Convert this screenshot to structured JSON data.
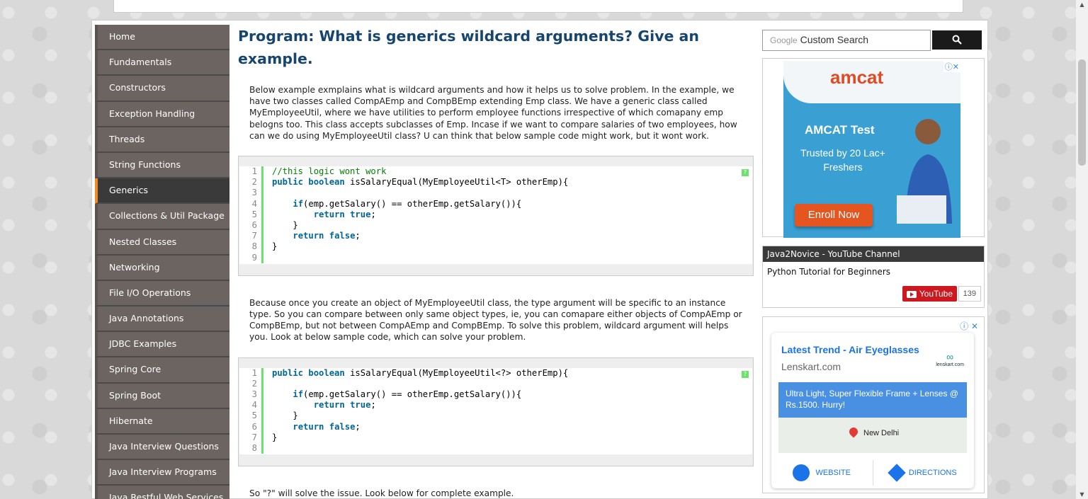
{
  "nav": {
    "items": [
      {
        "label": "Home",
        "active": false
      },
      {
        "label": "Fundamentals",
        "active": false
      },
      {
        "label": "Constructors",
        "active": false
      },
      {
        "label": "Exception Handling",
        "active": false
      },
      {
        "label": "Threads",
        "active": false
      },
      {
        "label": "String Functions",
        "active": false
      },
      {
        "label": "Generics",
        "active": true
      },
      {
        "label": "Collections & Util Package",
        "active": false
      },
      {
        "label": "Nested Classes",
        "active": false
      },
      {
        "label": "Networking",
        "active": false
      },
      {
        "label": "File I/O Operations",
        "active": false
      },
      {
        "label": "Java Annotations",
        "active": false
      },
      {
        "label": "JDBC Examples",
        "active": false
      },
      {
        "label": "Spring Core",
        "active": false
      },
      {
        "label": "Spring Boot",
        "active": false
      },
      {
        "label": "Hibernate",
        "active": false
      },
      {
        "label": "Java Interview Questions",
        "active": false
      },
      {
        "label": "Java Interview Programs",
        "active": false
      },
      {
        "label": "Java Restful Web Services",
        "active": false
      }
    ],
    "active_color": "#f08a24"
  },
  "main": {
    "title": "Program: What is generics wildcard arguments? Give an example.",
    "para1": "Below example exmplains what is wildcard arguments and how it helps us to solve problem. In the example, we have two classes called CompAEmp and CompBEmp extending Emp class. We have a generic class called MyEmployeeUtil, where we have utilities to perform employee functions irrespective of which comapany emp belogns too. This class accepts subclasses of Emp. Incase if we want to compare salaries of two employees, how can we do using MyEmployeeUtil class? U can think that below sample code might work, but it wont work.",
    "code1": [
      "//this logic wont work",
      "public boolean isSalaryEqual(MyEmployeeUtil<T> otherEmp){",
      "",
      "    if(emp.getSalary() == otherEmp.getSalary()){",
      "        return true;",
      "    }",
      "    return false;",
      "}",
      ""
    ],
    "para2": "Because once you create an object of MyEmployeeUtil class, the type argument will be specific to an instance type. So you can compare between only same object types, ie, you can comapare either objects of CompAEmp or CompBEmp, but not between CompAEmp and CompBEmp. To solve this problem, wildcard argument will helps you. Look at below sample code, which can solve your problem.",
    "code2": [
      "public boolean isSalaryEqual(MyEmployeeUtil<?> otherEmp){",
      "",
      "    if(emp.getSalary() == otherEmp.getSalary()){",
      "        return true;",
      "    }",
      "    return false;",
      "}",
      ""
    ],
    "para3": "So \"?\" will solve the issue. Look below for complete example.",
    "help_glyph": "?"
  },
  "search": {
    "brand": "Google",
    "placeholder": "Custom Search",
    "button_icon": "search-icon"
  },
  "ad1": {
    "logo": "amcat",
    "headline": "AMCAT Test",
    "tagline": "Trusted by 20 Lac+ Freshers",
    "cta": "Enroll Now",
    "adchoice": "ⓘ✕"
  },
  "youtube": {
    "header": "Java2Novice - YouTube Channel",
    "video": "Python Tutorial for Beginners",
    "button": "YouTube",
    "count": "139"
  },
  "ad2": {
    "adchoice": "ⓘ ✕",
    "title": "Latest Trend - Air Eyeglasses",
    "site": "Lenskart.com",
    "logo_text": "lenskart.com",
    "banner": "Ultra Light, Super Flexible Frame + Lenses @ Rs.1500. Hurry!",
    "city": "New Delhi",
    "website": "WEBSITE",
    "directions": "DIRECTIONS"
  }
}
